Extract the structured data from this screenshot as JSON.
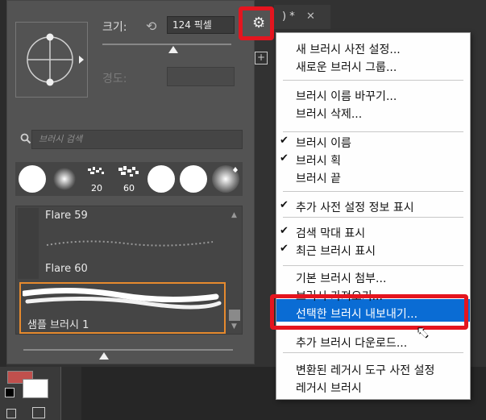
{
  "doc_tab": {
    "title": ") *",
    "close": "✕"
  },
  "brush_panel": {
    "size_label": "크기:",
    "size_value": "124 픽셀",
    "hardness_label": "경도:",
    "search_placeholder": "브러시 검색",
    "size_slider_value": 0.7,
    "recent_brushes": [
      {
        "label": ""
      },
      {
        "label": ""
      },
      {
        "label": "20"
      },
      {
        "label": "60"
      },
      {
        "label": ""
      },
      {
        "label": ""
      },
      {
        "label": ""
      }
    ],
    "list": [
      {
        "name": "Flare 59"
      },
      {
        "name": "Flare 60"
      },
      {
        "name": "샘플 브러시 1"
      }
    ]
  },
  "menu": {
    "items": [
      {
        "label": "새 브러시 사전 설정...",
        "checked": false
      },
      {
        "label": "새로운 브러시 그룹...",
        "checked": false
      },
      {
        "label": "브러시 이름 바꾸기...",
        "checked": false
      },
      {
        "label": "브러시 삭제...",
        "checked": false
      },
      {
        "label": "브러시 이름",
        "checked": true
      },
      {
        "label": "브러시 획",
        "checked": true
      },
      {
        "label": "브러시 끝",
        "checked": false
      },
      {
        "label": "추가 사전 설정 정보 표시",
        "checked": true
      },
      {
        "label": "검색 막대 표시",
        "checked": true
      },
      {
        "label": "최근 브러시 표시",
        "checked": true
      },
      {
        "label": "기본 브러시 첨부...",
        "checked": false
      },
      {
        "label": "브러시 가져오기...",
        "checked": false
      },
      {
        "label": "선택한 브러시 내보내기...",
        "checked": false,
        "highlighted": true
      },
      {
        "label": "추가 브러시 다운로드...",
        "checked": false
      },
      {
        "label": "변환된 레거시 도구 사전 설정",
        "checked": false
      },
      {
        "label": "레거시 브러시",
        "checked": false
      }
    ]
  },
  "colors": {
    "accent": "#0a6cd4",
    "annotation": "#e4151f",
    "selection": "#e68a2e"
  }
}
